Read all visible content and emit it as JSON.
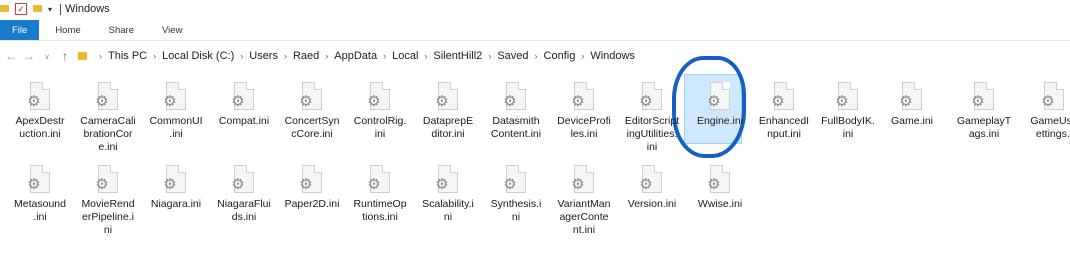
{
  "window": {
    "title": "Windows"
  },
  "ribbon": {
    "tabs": [
      "File",
      "Home",
      "Share",
      "View"
    ]
  },
  "address": {
    "crumbs": [
      "This PC",
      "Local Disk (C:)",
      "Users",
      "Raed",
      "AppData",
      "Local",
      "SilentHill2",
      "Saved",
      "Config",
      "Windows"
    ]
  },
  "files": [
    [
      "ApexDestr",
      "uction.ini"
    ],
    [
      "CameraCali",
      "brationCor",
      "e.ini"
    ],
    [
      "CommonUI",
      ".ini"
    ],
    [
      "Compat.ini"
    ],
    [
      "ConcertSyn",
      "cCore.ini"
    ],
    [
      "ControlRig.",
      "ini"
    ],
    [
      "DataprepE",
      "ditor.ini"
    ],
    [
      "Datasmith",
      "Content.ini"
    ],
    [
      "DeviceProfi",
      "les.ini"
    ],
    [
      "EditorScript",
      "ingUtilities.",
      "ini"
    ],
    [
      "Engine.ini"
    ],
    [
      "EnhancedI",
      "nput.ini"
    ],
    [
      "FullBodyIK.",
      "ini"
    ],
    [
      "Game.ini"
    ],
    [
      "GameplayT",
      "ags.ini"
    ],
    [
      "GameUse",
      "ettings.i"
    ],
    [
      "Metasound",
      ".ini"
    ],
    [
      "MovieRend",
      "erPipeline.i",
      "ni"
    ],
    [
      "Niagara.ini"
    ],
    [
      "NiagaraFlui",
      "ds.ini"
    ],
    [
      "Paper2D.ini"
    ],
    [
      "RuntimeOp",
      "tions.ini"
    ],
    [
      "Scalability.i",
      "ni"
    ],
    [
      "Synthesis.i",
      "ni"
    ],
    [
      "VariantMan",
      "agerConte",
      "nt.ini"
    ],
    [
      "Version.ini"
    ],
    [
      "Wwise.ini"
    ]
  ],
  "selected_index": 10,
  "colors": {
    "file_tab": "#1979ca",
    "selection": "#cde8ff",
    "annotation_circle": "#1560c0"
  },
  "icons": {
    "file": "ini-settings-file-icon",
    "folder": "folder-icon"
  }
}
